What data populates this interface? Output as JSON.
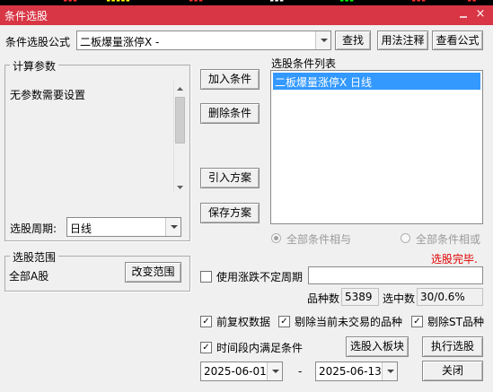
{
  "window": {
    "title": "条件选股",
    "close_glyph": "×"
  },
  "formula": {
    "label": "条件选股公式",
    "value": "二板爆量涨停X -",
    "find": "查找",
    "usage": "用法注释",
    "view": "查看公式"
  },
  "params": {
    "title": "计算参数",
    "message": "无参数需要设置",
    "period_label": "选股周期:",
    "period_value": "日线"
  },
  "actions": {
    "add": "加入条件",
    "remove": "删除条件",
    "import": "引入方案",
    "save": "保存方案"
  },
  "conditions": {
    "title": "选股条件列表",
    "items": [
      "二板爆量涨停X  日线"
    ]
  },
  "logic": {
    "all_and": "全部条件相与",
    "all_or": "全部条件相或",
    "status": "选股完毕."
  },
  "range": {
    "title": "选股范围",
    "value": "全部A股",
    "change": "改变范围"
  },
  "options": {
    "variable_period": "使用涨跌不定周期",
    "variable_period_value": "",
    "count_label": "品种数",
    "count_value": "5389",
    "selected_label": "选中数",
    "selected_value": "30/0.6%",
    "forward_adjust": "前复权数据",
    "exclude_untraded": "剔除当前未交易的品种",
    "exclude_st": "剔除ST品种",
    "time_range": "时间段内满足条件",
    "date_from": "2025-06-01",
    "date_sep": "-",
    "date_to": "2025-06-13"
  },
  "buttons": {
    "to_block": "选股入板块",
    "execute": "执行选股",
    "close": "关闭"
  },
  "colors": {
    "titlebar": "#d83545",
    "selection": "#3399ff",
    "status": "#e00000"
  }
}
